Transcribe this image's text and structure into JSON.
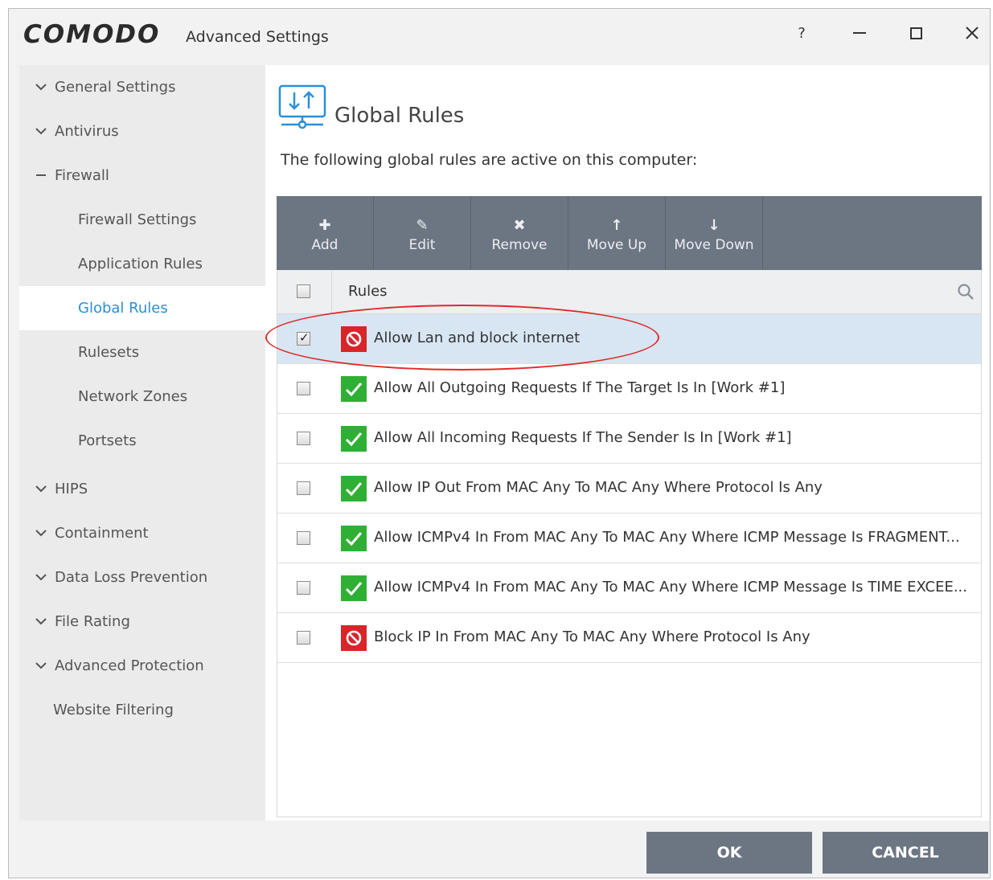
{
  "titlebar": {
    "logo": "COMODO",
    "title": "Advanced Settings",
    "help": "?"
  },
  "sidebar": {
    "items": [
      {
        "label": "General Settings"
      },
      {
        "label": "Antivirus"
      },
      {
        "label": "Firewall"
      },
      {
        "label": "Firewall Settings"
      },
      {
        "label": "Application Rules"
      },
      {
        "label": "Global Rules"
      },
      {
        "label": "Rulesets"
      },
      {
        "label": "Network Zones"
      },
      {
        "label": "Portsets"
      },
      {
        "label": "HIPS"
      },
      {
        "label": "Containment"
      },
      {
        "label": "Data Loss Prevention"
      },
      {
        "label": "File Rating"
      },
      {
        "label": "Advanced Protection"
      },
      {
        "label": "Website Filtering"
      }
    ]
  },
  "main": {
    "title": "Global Rules",
    "description": "The following global rules are active on this computer:",
    "toolbar": {
      "add": "Add",
      "edit": "Edit",
      "remove": "Remove",
      "move_up": "Move Up",
      "move_down": "Move Down"
    },
    "grid": {
      "column": "Rules",
      "rows": [
        {
          "label": "Allow Lan and block internet",
          "type": "block",
          "checked": true
        },
        {
          "label": "Allow All Outgoing Requests If The Target Is In [Work #1]",
          "type": "allow",
          "checked": false
        },
        {
          "label": "Allow All Incoming Requests If The Sender Is In [Work #1]",
          "type": "allow",
          "checked": false
        },
        {
          "label": "Allow IP Out From MAC Any To MAC Any Where Protocol Is Any",
          "type": "allow",
          "checked": false
        },
        {
          "label": "Allow ICMPv4 In From MAC Any To MAC Any Where ICMP Message Is FRAGMENT...",
          "type": "allow",
          "checked": false
        },
        {
          "label": "Allow ICMPv4 In From MAC Any To MAC Any Where ICMP Message Is TIME EXCEE...",
          "type": "allow",
          "checked": false
        },
        {
          "label": "Block IP In From MAC Any To MAC Any Where Protocol Is Any",
          "type": "block",
          "checked": false
        }
      ]
    }
  },
  "footer": {
    "ok": "OK",
    "cancel": "CANCEL"
  },
  "colors": {
    "accent": "#2a8fd6",
    "toolbar": "#6c7683",
    "allow": "#2fb035",
    "block": "#d9252a",
    "highlight": "#e02a2a"
  }
}
